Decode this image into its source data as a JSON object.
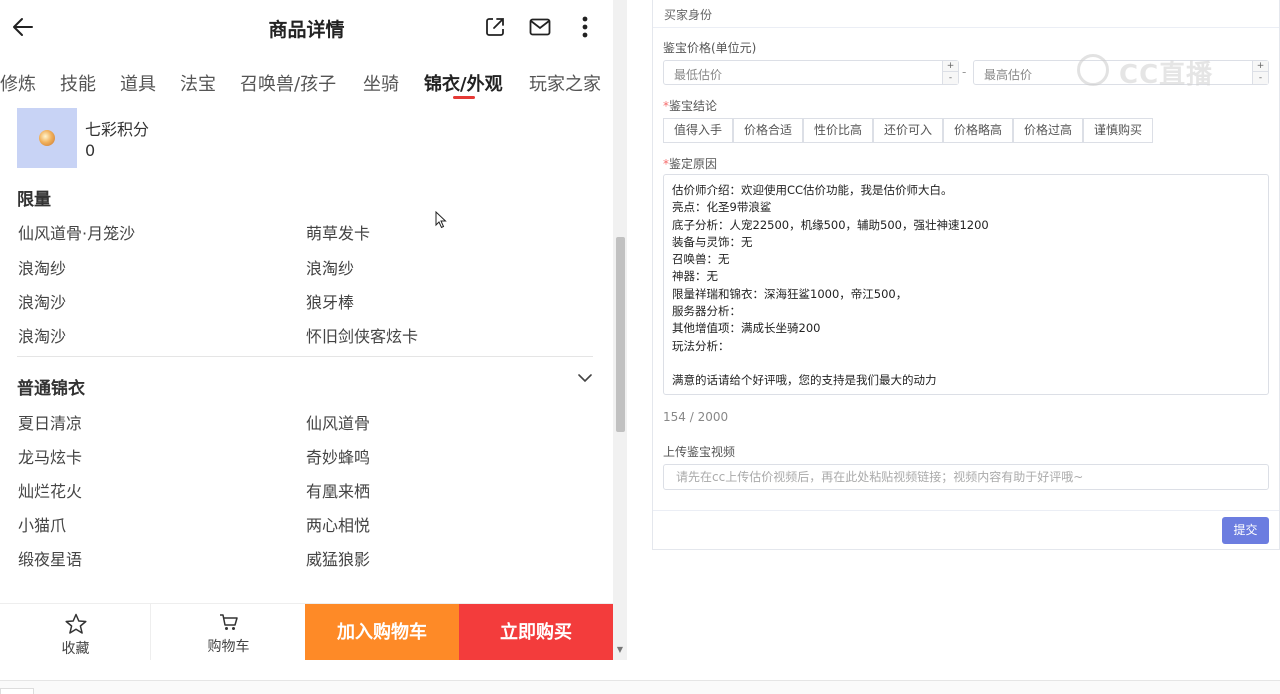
{
  "phone": {
    "title": "商品详情",
    "icons": [
      "back-icon",
      "share-icon",
      "mail-icon",
      "more-icon"
    ],
    "tabs": [
      {
        "label": "修炼"
      },
      {
        "label": "技能"
      },
      {
        "label": "道具"
      },
      {
        "label": "法宝"
      },
      {
        "label": "召唤兽/孩子"
      },
      {
        "label": "坐骑"
      },
      {
        "label": "锦衣/外观",
        "active": true
      },
      {
        "label": "玩家之家"
      }
    ],
    "points": {
      "name": "七彩积分",
      "value": "0"
    },
    "limited": {
      "title": "限量",
      "items": [
        "仙风道骨·月笼沙",
        "萌草发卡",
        "浪淘纱",
        "浪淘纱",
        "浪淘沙",
        "狼牙棒",
        "浪淘沙",
        "怀旧剑侠客炫卡"
      ]
    },
    "normal": {
      "title": "普通锦衣",
      "items": [
        "夏日清凉",
        "仙风道骨",
        "龙马炫卡",
        "奇妙蜂鸣",
        "灿烂花火",
        "有凰来栖",
        "小猫爪",
        "两心相悦",
        "缎夜星语",
        "威猛狼影"
      ]
    },
    "bottom": {
      "favorite": "收藏",
      "cart": "购物车",
      "add_to_cart": "加入购物车",
      "buy_now": "立即购买"
    },
    "colors": {
      "add_to_cart": "#fe8a27",
      "buy_now": "#f33c3c",
      "tab_underline": "#e53935"
    }
  },
  "form": {
    "header": "买家身份",
    "price": {
      "label": "鉴宝价格(单位元)",
      "min_placeholder": "最低估价",
      "max_placeholder": "最高估价",
      "separator": "-"
    },
    "watermark": "CC直播",
    "conclusion": {
      "label": "鉴宝结论",
      "options": [
        "值得入手",
        "价格合适",
        "性价比高",
        "还价可入",
        "价格略高",
        "价格过高",
        "谨慎购买"
      ]
    },
    "reason": {
      "label": "鉴定原因",
      "lines": [
        "估价师介绍：欢迎使用CC估价功能，我是估价师大白。",
        "亮点：化圣9带浪鲨",
        "底子分析：人宠22500，机缘500，辅助500，强壮神速1200",
        "装备与灵饰：无",
        "召唤兽：无",
        "神器：无",
        "限量祥瑞和锦衣：深海狂鲨1000，帝江500，",
        "服务器分析：",
        "其他增值项：满成长坐骑200",
        "玩法分析：",
        "",
        "满意的话请给个好评哦，您的支持是我们最大的动力"
      ],
      "counter": "154 / 2000"
    },
    "video": {
      "label": "上传鉴宝视频",
      "placeholder": "请先在cc上传估价视频后，再在此处粘贴视频链接；视频内容有助于好评哦~"
    },
    "submit": "提交",
    "colors": {
      "submit": "#6c7de0",
      "required": "#f56c6c"
    }
  }
}
